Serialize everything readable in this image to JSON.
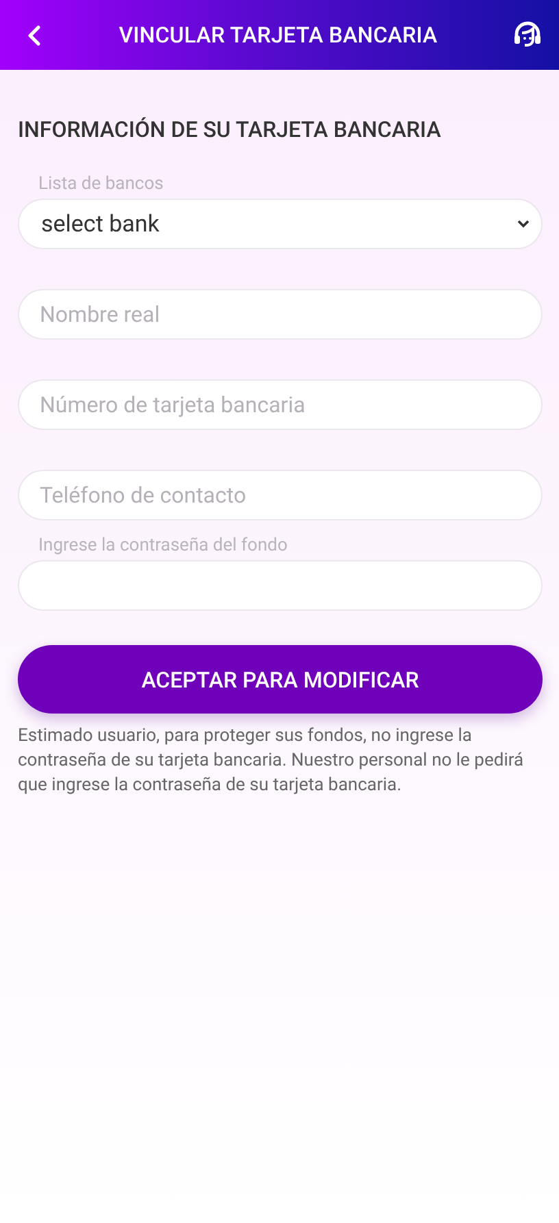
{
  "header": {
    "title": "VINCULAR TARJETA BANCARIA"
  },
  "section_title": "INFORMACIÓN DE SU TARJETA BANCARIA",
  "fields": [
    {
      "kind": "select",
      "label": "Lista de bancos",
      "value": "select bank"
    },
    {
      "kind": "text",
      "placeholder": "Nombre real"
    },
    {
      "kind": "text",
      "placeholder": "Número de tarjeta bancaria"
    },
    {
      "kind": "text",
      "placeholder": "Teléfono de contacto"
    },
    {
      "kind": "password",
      "label": "Ingrese la contraseña del fondo"
    }
  ],
  "submit_button": "ACEPTAR PARA MODIFICAR",
  "notice": "Estimado usuario, para proteger sus fondos, no ingrese la contraseña de su tarjeta bancaria. Nuestro personal no le pedirá que ingrese la contraseña de su tarjeta bancaria."
}
